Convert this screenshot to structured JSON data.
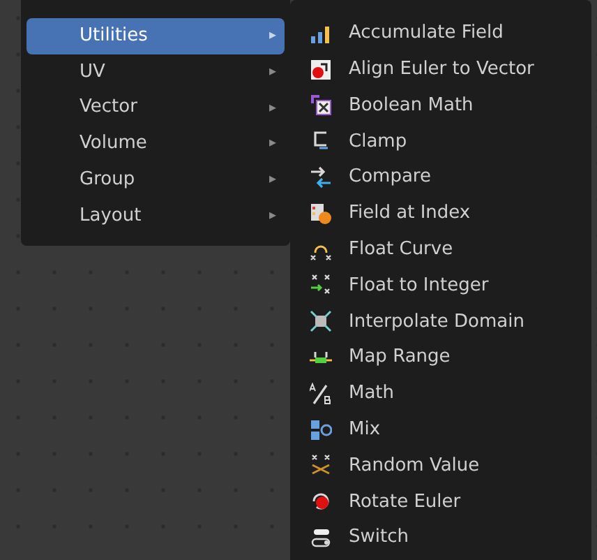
{
  "category_menu": {
    "items": [
      {
        "label": "Utilities",
        "selected": true,
        "arrow": "▸"
      },
      {
        "label": "UV",
        "selected": false,
        "arrow": "▸"
      },
      {
        "label": "Vector",
        "selected": false,
        "arrow": "▸"
      },
      {
        "label": "Volume",
        "selected": false,
        "arrow": "▸"
      },
      {
        "label": "Group",
        "selected": false,
        "arrow": "▸"
      },
      {
        "label": "Layout",
        "selected": false,
        "arrow": "▸"
      }
    ]
  },
  "submenu": {
    "items": [
      {
        "label": "Accumulate Field"
      },
      {
        "label": "Align Euler to Vector"
      },
      {
        "label": "Boolean Math"
      },
      {
        "label": "Clamp"
      },
      {
        "label": "Compare"
      },
      {
        "label": "Field at Index"
      },
      {
        "label": "Float Curve"
      },
      {
        "label": "Float to Integer"
      },
      {
        "label": "Interpolate Domain"
      },
      {
        "label": "Map Range"
      },
      {
        "label": "Math"
      },
      {
        "label": "Mix"
      },
      {
        "label": "Random Value"
      },
      {
        "label": "Rotate Euler"
      },
      {
        "label": "Switch"
      }
    ]
  }
}
